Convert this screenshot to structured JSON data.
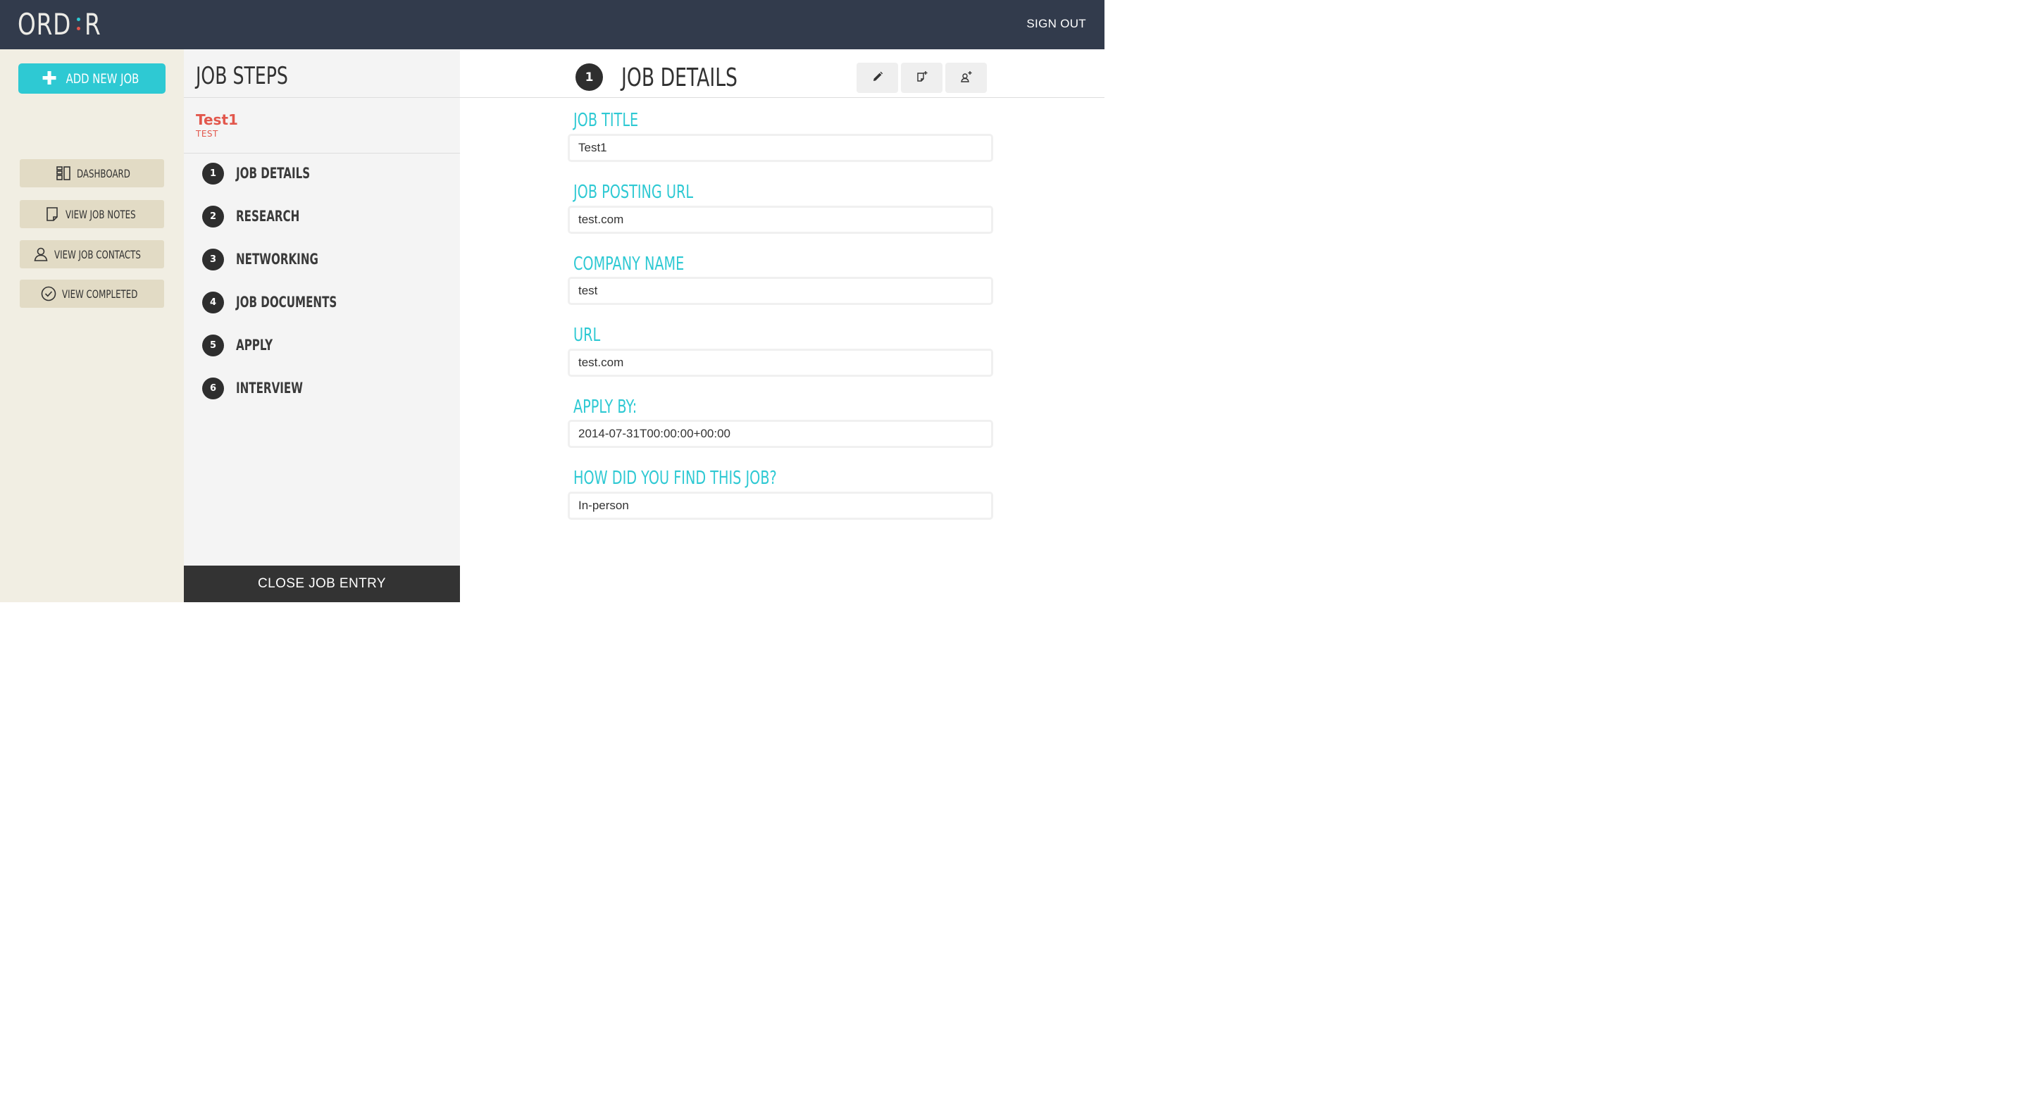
{
  "header": {
    "logo_left": "ORD",
    "logo_right": "R",
    "logo_dot_top_color": "#2ec9d3",
    "logo_dot_bottom_color": "#e2574c",
    "signout_label": "SIGN OUT"
  },
  "sidebar": {
    "add_job_label": "ADD NEW JOB",
    "items": [
      {
        "label": "DASHBOARD",
        "icon": "dashboard-icon"
      },
      {
        "label": "VIEW JOB NOTES",
        "icon": "note-icon"
      },
      {
        "label": "VIEW JOB CONTACTS",
        "icon": "person-icon"
      },
      {
        "label": "VIEW COMPLETED",
        "icon": "check-circle-icon"
      }
    ]
  },
  "steps_panel": {
    "title": "JOB STEPS",
    "job_name": "Test1",
    "job_company": "TEST",
    "steps": [
      {
        "num": "1",
        "label": "JOB DETAILS"
      },
      {
        "num": "2",
        "label": "RESEARCH"
      },
      {
        "num": "3",
        "label": "NETWORKING"
      },
      {
        "num": "4",
        "label": "JOB DOCUMENTS"
      },
      {
        "num": "5",
        "label": "APPLY"
      },
      {
        "num": "6",
        "label": "INTERVIEW"
      }
    ],
    "close_label": "CLOSE JOB ENTRY"
  },
  "main": {
    "step_num": "1",
    "title": "JOB DETAILS",
    "tools": [
      "pencil-icon",
      "add-note-icon",
      "add-contact-icon"
    ],
    "fields": [
      {
        "label": "JOB TITLE",
        "value": "Test1"
      },
      {
        "label": "JOB POSTING URL",
        "value": "test.com"
      },
      {
        "label": "COMPANY NAME",
        "value": "test"
      },
      {
        "label": "URL",
        "value": "test.com"
      },
      {
        "label": "APPLY BY:",
        "value": "2014-07-31T00:00:00+00:00"
      },
      {
        "label": "HOW DID YOU FIND THIS JOB?",
        "value": "In-person"
      }
    ]
  },
  "colors": {
    "topbar": "#323b4c",
    "accent": "#2ec9d3",
    "job_name": "#e2574c",
    "sidebar_bg": "#f1eee3",
    "sidebar_button": "#e2dbc5"
  }
}
